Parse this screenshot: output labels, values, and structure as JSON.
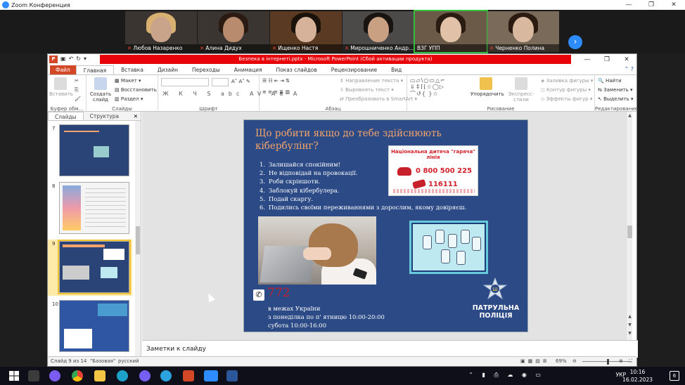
{
  "zoom": {
    "title": "Zoom Конференция",
    "participants": [
      {
        "name": "Любов Назаренко",
        "muted": true
      },
      {
        "name": "Алина Дидух",
        "muted": true
      },
      {
        "name": "Ищенко Настя",
        "muted": true
      },
      {
        "name": "Мирошниченко Андр...",
        "muted": true
      },
      {
        "name": "ВЗГ УПП",
        "muted": false
      },
      {
        "name": "Черненко Полина",
        "muted": true
      }
    ],
    "next_icon": "chevron-right-icon"
  },
  "ppt": {
    "window_title": "Безпека в інтернеті.pptx  -  Microsoft PowerPoint (Сбой активации продукта)",
    "tabs": [
      "Файл",
      "Главная",
      "Вставка",
      "Дизайн",
      "Переходы",
      "Анимация",
      "Показ слайдов",
      "Рецензирование",
      "Вид"
    ],
    "active_tab": "Главная",
    "ribbon": {
      "clipboard": {
        "paste": "Вставить",
        "label": "Буфер обм..."
      },
      "slides": {
        "create": "Создать слайд",
        "layout": "Макет",
        "restore": "Восстановить",
        "section": "Раздел",
        "label": "Слайды"
      },
      "font": {
        "label": "Шрифт",
        "format_buttons": "Ж К Ч S abc AV Aa A"
      },
      "paragraph": {
        "text_direction": "Направление текста",
        "align_text": "Выровнять текст",
        "smartart": "Преобразовать в SmartArt",
        "label": "Абзац"
      },
      "drawing": {
        "arrange": "Упорядочить",
        "quick_styles": "Экспресс-стили",
        "fill": "Заливка фигуры",
        "outline": "Контур фигуры",
        "effects": "Эффекты фигур",
        "label": "Рисование"
      },
      "editing": {
        "find": "Найти",
        "replace": "Заменить",
        "select": "Выделить",
        "label": "Редактирование"
      }
    },
    "panel_tabs": [
      "Слайды",
      "Структура"
    ],
    "thumbnails": [
      {
        "number": "7",
        "selected": false
      },
      {
        "number": "8",
        "selected": false
      },
      {
        "number": "9",
        "selected": true
      },
      {
        "number": "10",
        "selected": false
      }
    ],
    "notes_placeholder": "Заметки к слайду",
    "status": {
      "slide_info": "Слайд 9 из 14",
      "theme": "\"Базовая\"",
      "language": "русский",
      "zoom": "69%"
    }
  },
  "slide": {
    "title": "Що робити якщо до тебе здійснюють кібербулінг?",
    "steps": [
      "Залишайся спокійним!",
      "Не відповідай на провокації.",
      "Роби скріншоти.",
      "Заблокуй кібербулера.",
      "Подай скаргу.",
      "Подились своїми переживаннями з дорослим, якому довіряєш."
    ],
    "hotline": {
      "title": "Національна дитяча \"гаряча\" лінія",
      "phone_landline": "0 800 500 225",
      "phone_mobile": "116111"
    },
    "short_number": "772",
    "contact_lines": [
      "в межах України",
      "з понеділка по п' ятницю 10:00-20:00",
      "субота 10:00-16:00"
    ],
    "police_label": "ПАТРУЛЬНА ПОЛІЦІЯ"
  },
  "taskbar": {
    "language": "УКР",
    "time": "10:16",
    "date": "16.02.2023",
    "notifications": "6"
  }
}
